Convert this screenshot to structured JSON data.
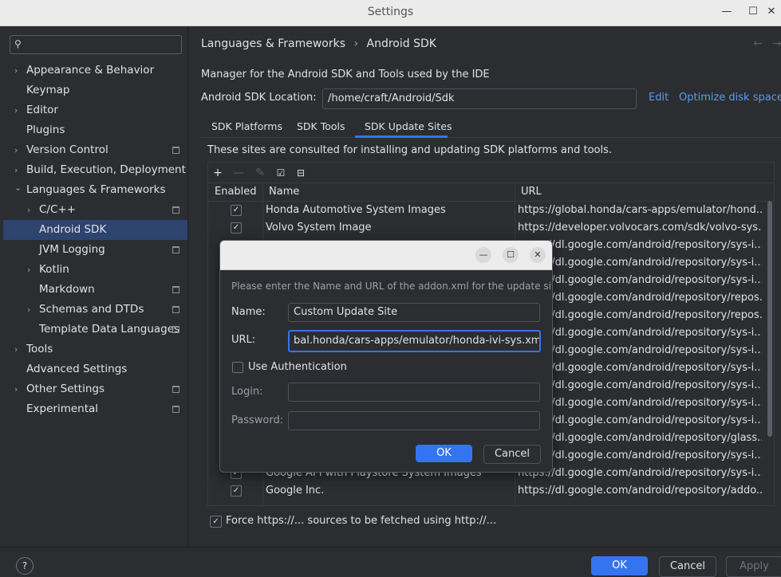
{
  "window": {
    "title": "Settings",
    "minimize": "—",
    "maximize": "☐",
    "close": "✕"
  },
  "sidebar": {
    "search_placeholder": "",
    "items": [
      {
        "label": "Appearance & Behavior",
        "chevron": "›"
      },
      {
        "label": "Keymap"
      },
      {
        "label": "Editor",
        "chevron": "›"
      },
      {
        "label": "Plugins"
      },
      {
        "label": "Version Control",
        "chevron": "›"
      },
      {
        "label": "Build, Execution, Deployment",
        "chevron": "›"
      },
      {
        "label": "Languages & Frameworks",
        "chevron": "⌄"
      },
      {
        "label": "C/C++",
        "chevron": "›"
      },
      {
        "label": "Android SDK"
      },
      {
        "label": "JVM Logging"
      },
      {
        "label": "Kotlin",
        "chevron": "›"
      },
      {
        "label": "Markdown"
      },
      {
        "label": "Schemas and DTDs",
        "chevron": "›"
      },
      {
        "label": "Template Data Languages"
      },
      {
        "label": "Tools",
        "chevron": "›"
      },
      {
        "label": "Advanced Settings"
      },
      {
        "label": "Other Settings",
        "chevron": "›"
      },
      {
        "label": "Experimental"
      }
    ]
  },
  "header": {
    "crumb1": "Languages & Frameworks",
    "sep": "›",
    "crumb2": "Android SDK"
  },
  "main": {
    "description": "Manager for the Android SDK and Tools used by the IDE",
    "location_label": "Android SDK Location:",
    "location_value": "/home/craft/Android/Sdk",
    "edit_link": "Edit",
    "optimize_link": "Optimize disk space",
    "tabs": [
      "SDK Platforms",
      "SDK Tools",
      "SDK Update Sites"
    ],
    "sites_info": "These sites are consulted for installing and updating SDK platforms and tools.",
    "table": {
      "headers": [
        "Enabled",
        "Name",
        "URL"
      ],
      "rows": [
        {
          "name": "Honda Automotive System Images",
          "url": "https://global.honda/cars-apps/emulator/hond...",
          "checked": "✓"
        },
        {
          "name": "Volvo System Image",
          "url": "https://developer.volvocars.com/sdk/volvo-sys...",
          "checked": "✓"
        },
        {
          "name": "",
          "url": "https://dl.google.com/android/repository/sys-i...",
          "checked": ""
        },
        {
          "name": "",
          "url": "https://dl.google.com/android/repository/sys-i...",
          "checked": ""
        },
        {
          "name": "",
          "url": "https://dl.google.com/android/repository/sys-i...",
          "checked": ""
        },
        {
          "name": "",
          "url": "https://dl.google.com/android/repository/repos...",
          "checked": ""
        },
        {
          "name": "",
          "url": "https://dl.google.com/android/repository/repos...",
          "checked": ""
        },
        {
          "name": "",
          "url": "https://dl.google.com/android/repository/sys-i...",
          "checked": ""
        },
        {
          "name": "",
          "url": "https://dl.google.com/android/repository/sys-i...",
          "checked": ""
        },
        {
          "name": "",
          "url": "https://dl.google.com/android/repository/sys-i...",
          "checked": ""
        },
        {
          "name": "",
          "url": "https://dl.google.com/android/repository/sys-i...",
          "checked": ""
        },
        {
          "name": "",
          "url": "https://dl.google.com/android/repository/sys-i...",
          "checked": ""
        },
        {
          "name": "",
          "url": "https://dl.google.com/android/repository/sys-i...",
          "checked": ""
        },
        {
          "name": "",
          "url": "https://dl.google.com/android/repository/glass...",
          "checked": ""
        },
        {
          "name": "",
          "url": "https://dl.google.com/android/repository/sys-i...",
          "checked": ""
        },
        {
          "name": "Google API with Playstore System Images",
          "url": "https://dl.google.com/android/repository/sys-i...",
          "checked": "✓"
        },
        {
          "name": "Google Inc.",
          "url": "https://dl.google.com/android/repository/addo...",
          "checked": "✓"
        }
      ]
    },
    "force_label": "Force https://... sources to be fetched using http://...",
    "force_checked": "✓"
  },
  "footer": {
    "help": "?",
    "ok": "OK",
    "cancel": "Cancel",
    "apply": "Apply"
  },
  "dialog": {
    "prompt": "Please enter the Name and URL of the addon.xml for the update site",
    "name_label": "Name:",
    "name_value": "Custom Update Site",
    "url_label": "URL:",
    "url_value": "bal.honda/cars-apps/emulator/honda-ivi-sys.xml",
    "auth_label": "Use Authentication",
    "login_label": "Login:",
    "password_label": "Password:",
    "ok": "OK",
    "cancel": "Cancel",
    "minimize": "—",
    "maximize": "☐",
    "close": "✕"
  },
  "colors": {
    "accent": "#3574f0",
    "selection": "#2e436e",
    "link": "#5a9bf0"
  }
}
